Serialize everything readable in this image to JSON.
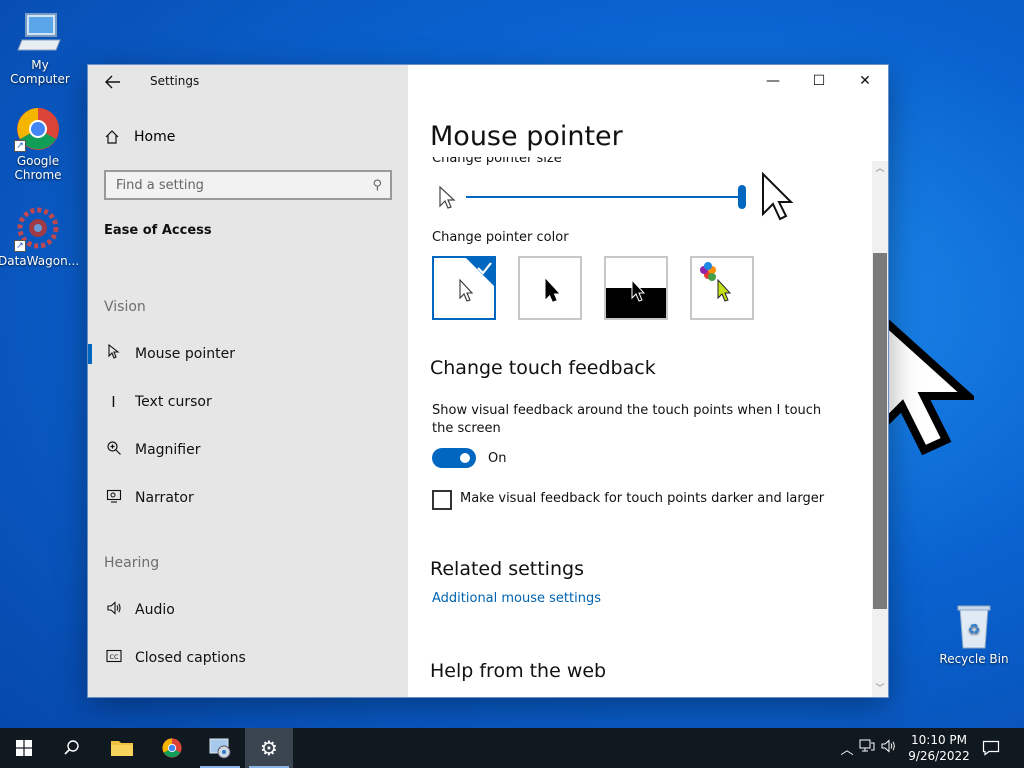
{
  "desktop": {
    "icons": [
      {
        "label": "My Computer",
        "icon": "computer-icon"
      },
      {
        "label": "Google Chrome",
        "icon": "chrome-icon"
      },
      {
        "label": "DataWagon...",
        "icon": "datawagon-icon"
      },
      {
        "label": "Recycle Bin",
        "icon": "recycle-bin-icon"
      }
    ]
  },
  "window": {
    "app_title": "Settings",
    "controls": {
      "minimize": "—",
      "maximize": "☐",
      "close": "✕"
    },
    "sidebar": {
      "home_label": "Home",
      "search_placeholder": "Find a setting",
      "section_title": "Ease of Access",
      "groups": [
        {
          "label": "Vision"
        },
        {
          "label": "Hearing"
        }
      ],
      "items": [
        {
          "label": "Mouse pointer",
          "icon": "mouse-pointer-icon",
          "active": true
        },
        {
          "label": "Text cursor",
          "icon": "text-cursor-icon"
        },
        {
          "label": "Magnifier",
          "icon": "magnifier-icon"
        },
        {
          "label": "Narrator",
          "icon": "narrator-icon"
        },
        {
          "label": "Audio",
          "icon": "audio-icon"
        },
        {
          "label": "Closed captions",
          "icon": "closed-captions-icon"
        }
      ]
    },
    "main": {
      "page_title": "Mouse pointer",
      "pointer_size_label": "Change pointer size",
      "pointer_size_level": 15,
      "pointer_size_max": 15,
      "pointer_color_label": "Change pointer color",
      "pointer_color_options": [
        "white",
        "black",
        "inverted",
        "custom"
      ],
      "pointer_color_selected": "white",
      "touch_heading": "Change touch feedback",
      "touch_description": "Show visual feedback around the touch points when I touch the screen",
      "toggle_state": "On",
      "darker_checkbox_label": "Make visual feedback for touch points darker and larger",
      "darker_checked": false,
      "related_heading": "Related settings",
      "related_link": "Additional mouse settings",
      "help_heading": "Help from the web"
    }
  },
  "taskbar": {
    "time": "10:10 PM",
    "date": "9/26/2022"
  },
  "colors": {
    "accent": "#0067c0",
    "sidebar_bg": "#e6e6e6",
    "taskbar_bg": "#101820",
    "link": "#0063b1"
  }
}
